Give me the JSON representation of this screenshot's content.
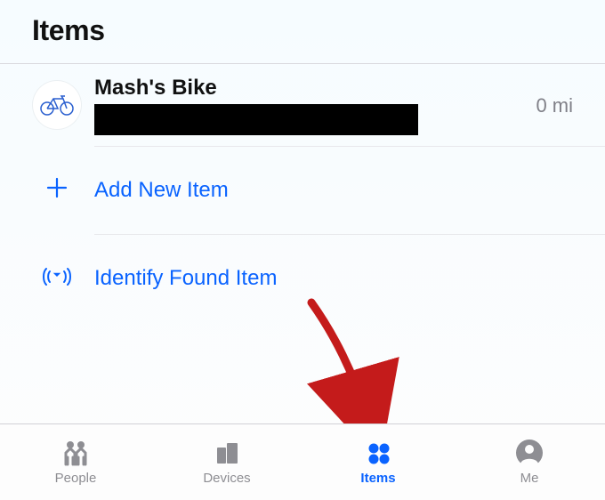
{
  "colors": {
    "accent": "#0a63ff",
    "muted": "#8e8e93"
  },
  "header": {
    "title": "Items"
  },
  "item": {
    "title": "Mash's Bike",
    "icon": "bike-icon",
    "distance": "0 mi"
  },
  "actions": {
    "add": {
      "label": "Add New Item",
      "icon": "plus-icon"
    },
    "identify": {
      "label": "Identify Found Item",
      "icon": "location-broadcast-icon"
    }
  },
  "tabs": {
    "people": {
      "label": "People",
      "active": false
    },
    "devices": {
      "label": "Devices",
      "active": false
    },
    "items": {
      "label": "Items",
      "active": true
    },
    "me": {
      "label": "Me",
      "active": false
    }
  },
  "annotation": {
    "arrow_points_to": "items-tab"
  }
}
